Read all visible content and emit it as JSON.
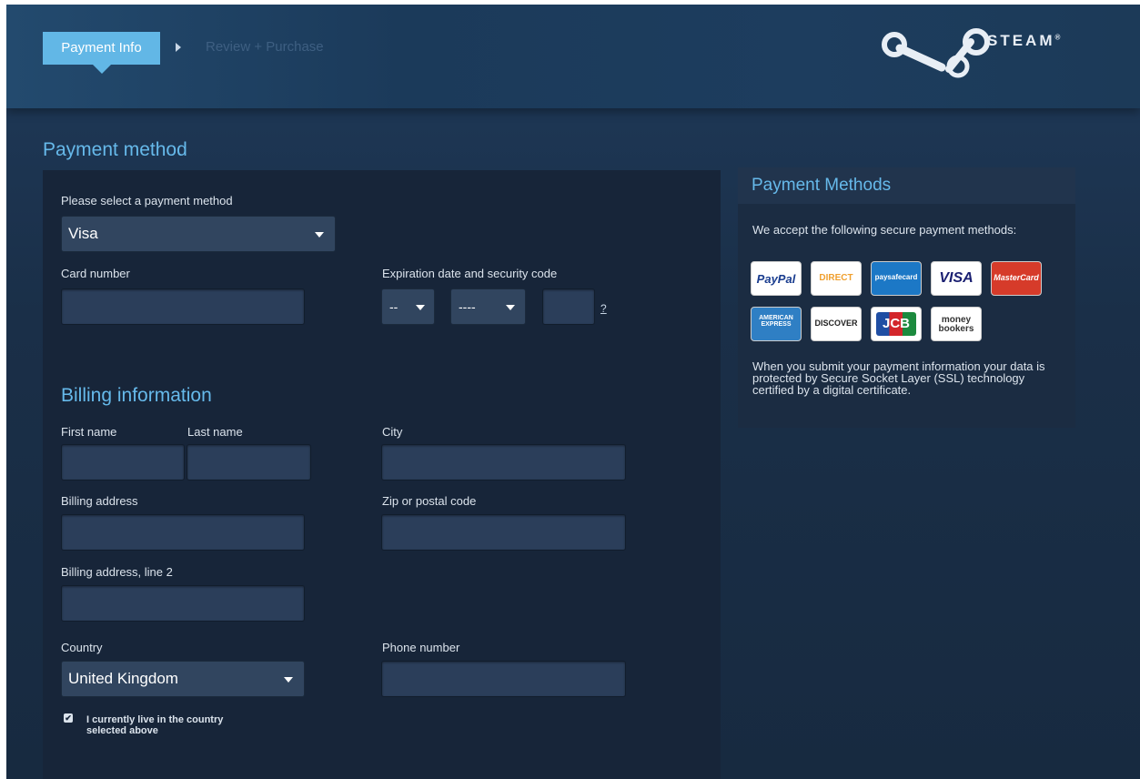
{
  "steps": {
    "active": "Payment Info",
    "next": "Review + Purchase"
  },
  "brand": {
    "name": "STEAM",
    "mark": "®"
  },
  "payment": {
    "heading": "Payment method",
    "select_label": "Please select a payment method",
    "method": "Visa",
    "card_number_label": "Card number",
    "expiry_label": "Expiration date and security code",
    "expiry_month": "--",
    "expiry_year": "----",
    "cvv_help": "?"
  },
  "billing": {
    "heading": "Billing information",
    "first_name_label": "First name",
    "last_name_label": "Last name",
    "city_label": "City",
    "address_label": "Billing address",
    "zip_label": "Zip or postal code",
    "address2_label": "Billing address, line 2",
    "country_label": "Country",
    "country": "United Kingdom",
    "phone_label": "Phone number",
    "residence_checkbox_label": "I currently live in the country selected above",
    "residence_checked": true
  },
  "sidebar": {
    "title": "Payment Methods",
    "intro": "We accept the following secure payment methods:",
    "note": "When you submit your payment information your data is protected by Secure Socket Layer (SSL) technology certified by a digital certificate.",
    "logos": {
      "paypal": "PayPal",
      "direct": "DIRECT",
      "paysafe": "paysafecard",
      "visa": "VISA",
      "mastercard": "MasterCard",
      "amex_1": "AMERICAN",
      "amex_2": "EXPRESS",
      "discover": "DISCOVER",
      "jcb": "JCB",
      "moneybookers_1": "money",
      "moneybookers_2": "bookers"
    }
  },
  "colors": {
    "accent": "#66b9ea",
    "step_active": "#62b7e6",
    "panel": "#172539",
    "field": "#2b3e5a"
  }
}
